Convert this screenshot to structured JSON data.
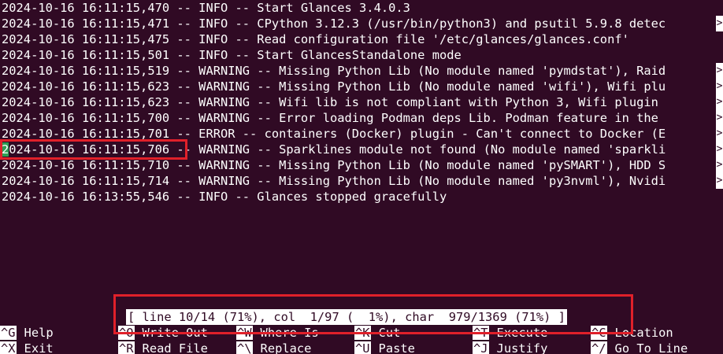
{
  "log_lines": [
    "2024-10-16 16:11:15,470 -- INFO -- Start Glances 3.4.0.3",
    "2024-10-16 16:11:15,471 -- INFO -- CPython 3.12.3 (/usr/bin/python3) and psutil 5.9.8 detec",
    "2024-10-16 16:11:15,475 -- INFO -- Read configuration file '/etc/glances/glances.conf'",
    "2024-10-16 16:11:15,501 -- INFO -- Start GlancesStandalone mode",
    "2024-10-16 16:11:15,519 -- WARNING -- Missing Python Lib (No module named 'pymdstat'), Raid",
    "2024-10-16 16:11:15,623 -- WARNING -- Missing Python Lib (No module named 'wifi'), Wifi plu",
    "2024-10-16 16:11:15,623 -- WARNING -- Wifi lib is not compliant with Python 3, Wifi plugin ",
    "2024-10-16 16:11:15,700 -- WARNING -- Error loading Podman deps Lib. Podman feature in the ",
    "2024-10-16 16:11:15,701 -- ERROR -- containers (Docker) plugin - Can't connect to Docker (E",
    "2024-10-16 16:11:15,706 -- WARNING -- Sparklines module not found (No module named 'sparkli",
    "2024-10-16 16:11:15,710 -- WARNING -- Missing Python Lib (No module named 'pySMART'), HDD S",
    "2024-10-16 16:11:15,714 -- WARNING -- Missing Python Lib (No module named 'py3nvml'), Nvidi",
    "2024-10-16 16:13:55,546 -- INFO -- Glances stopped gracefully"
  ],
  "cursor_line": {
    "cursor_char": "2",
    "rest": "024-10-16 16:11:15,706 -- WARNING -- Sparklines module not found (No module named 'sparkli"
  },
  "overflow_marker": ">",
  "status_bar": "[ line 10/14 (71%), col  1/97 (  1%), char  979/1369 (71%) ]",
  "shortcuts_row1": [
    {
      "key": "^G",
      "label": "Help"
    },
    {
      "key": "^O",
      "label": "Write Out"
    },
    {
      "key": "^W",
      "label": "Where Is"
    },
    {
      "key": "^K",
      "label": "Cut"
    },
    {
      "key": "^T",
      "label": "Execute"
    },
    {
      "key": "^C",
      "label": "Location"
    }
  ],
  "shortcuts_row2": [
    {
      "key": "^X",
      "label": "Exit"
    },
    {
      "key": "^R",
      "label": "Read File"
    },
    {
      "key": "^\\",
      "label": "Replace"
    },
    {
      "key": "^U",
      "label": "Paste"
    },
    {
      "key": "^J",
      "label": "Justify"
    },
    {
      "key": "^/",
      "label": "Go To Line"
    }
  ],
  "colors": {
    "background": "#300a24",
    "text": "#ffffff",
    "cursor": "#2e9e55",
    "highlight_box": "#e0202a"
  }
}
